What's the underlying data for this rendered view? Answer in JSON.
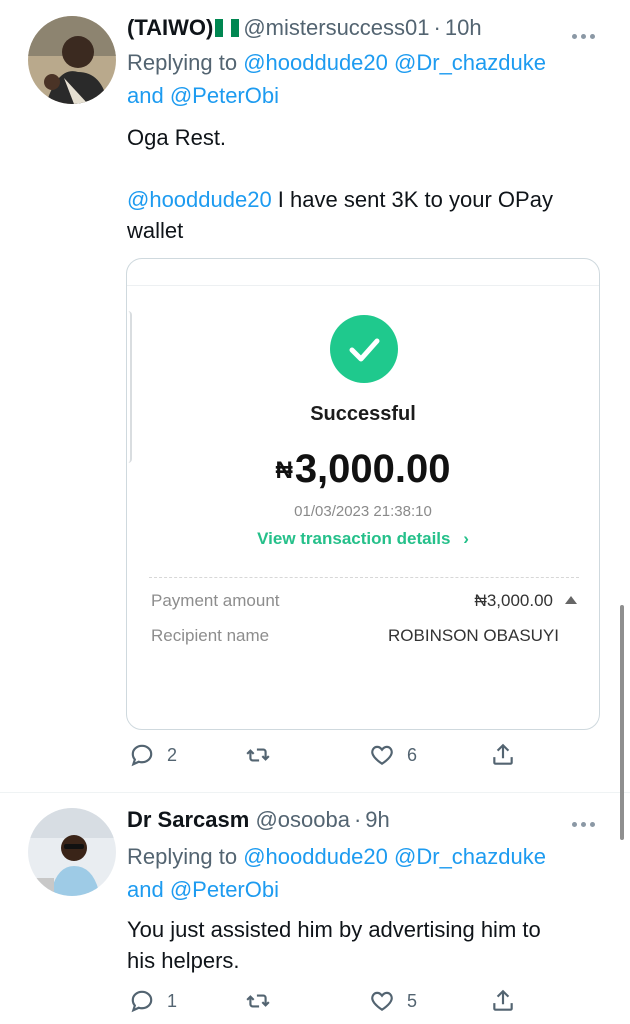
{
  "tweets": [
    {
      "author_name": "(TAIWO)",
      "flag_icon": "nigeria-flag-icon",
      "handle": "@mistersuccess01",
      "separator": "·",
      "time": "10h",
      "replying_prefix": "Replying to",
      "replying_users": [
        "@hooddude20",
        "@Dr_chazduke"
      ],
      "replying_and": "and",
      "replying_last": "@PeterObi",
      "text_line1": "Oga Rest.",
      "text_mention": "@hooddude20",
      "text_line2": " I have sent 3K to your OPay",
      "text_line3": "wallet",
      "counts": {
        "replies": "2",
        "retweets": "",
        "likes": "6"
      }
    },
    {
      "author_name": "Dr Sarcasm",
      "handle": "@osooba",
      "separator": "·",
      "time": "9h",
      "replying_prefix": "Replying to",
      "replying_users": [
        "@hooddude20",
        "@Dr_chazduke"
      ],
      "replying_and": "and",
      "replying_last": "@PeterObi",
      "text_line1": "You just assisted him by advertising him to",
      "text_line2": "his helpers.",
      "counts": {
        "replies": "1",
        "retweets": "",
        "likes": "5"
      }
    }
  ],
  "receipt": {
    "status": "Successful",
    "currency_symbol": "₦",
    "amount": "3,000.00",
    "datetime": "01/03/2023 21:38:10",
    "view_details": "View transaction details",
    "view_details_chevron": "›",
    "payment_amount_label": "Payment amount",
    "payment_amount_value": "₦3,000.00",
    "recipient_label": "Recipient name",
    "recipient_value": "ROBINSON OBASUYI"
  },
  "colors": {
    "link": "#1d9bf0",
    "success_green": "#1fc98d",
    "text_secondary": "#536471"
  }
}
